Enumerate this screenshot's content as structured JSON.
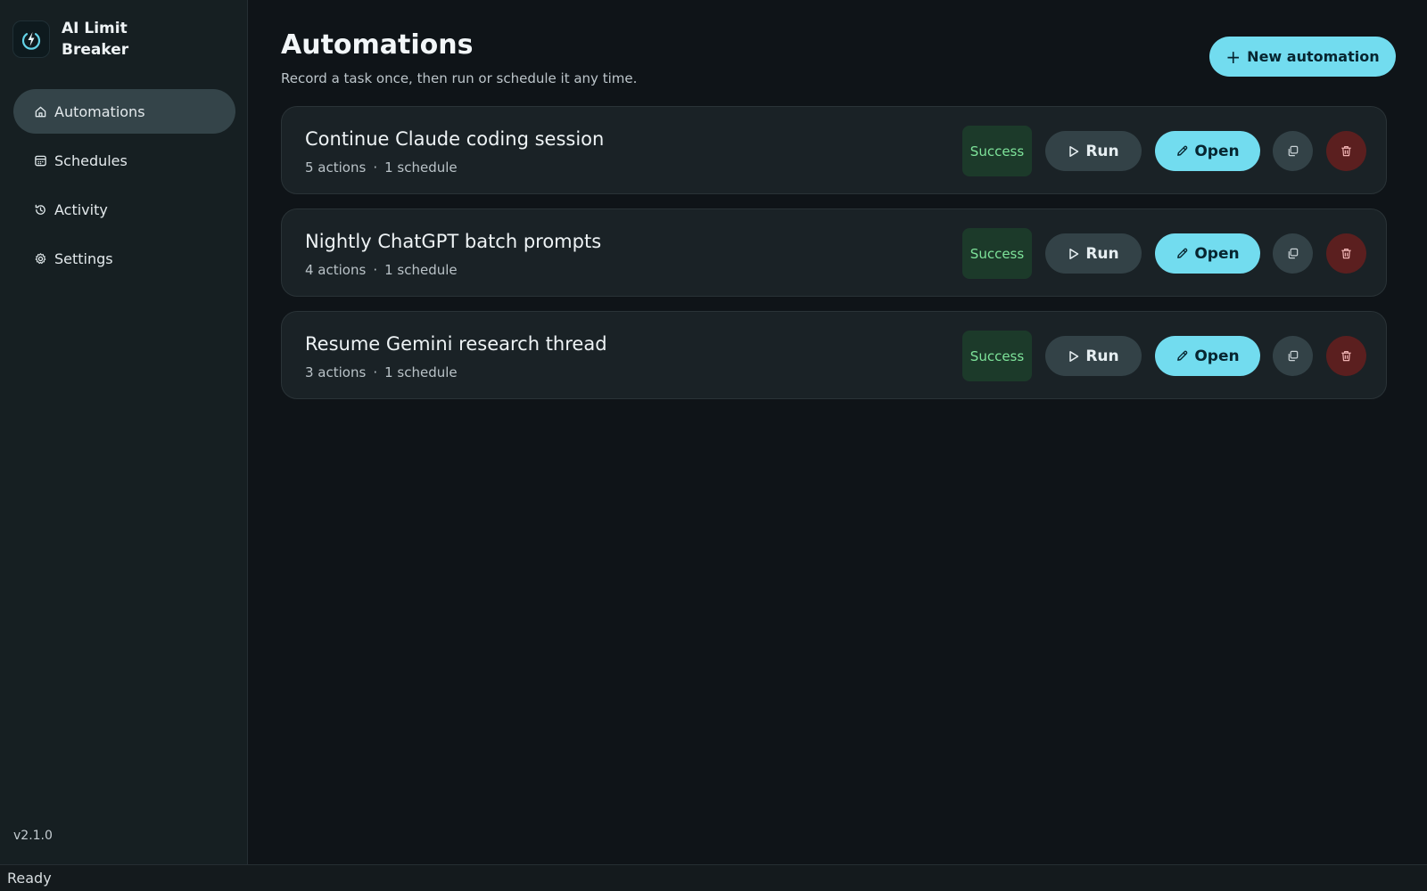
{
  "app": {
    "name": "AI Limit Breaker",
    "version": "v2.1.0",
    "status": "Ready",
    "logo_icon": "lightning-power-icon"
  },
  "sidebar": {
    "items": [
      {
        "label": "Automations",
        "icon": "home-icon",
        "active": true
      },
      {
        "label": "Schedules",
        "icon": "calendar-icon",
        "active": false
      },
      {
        "label": "Activity",
        "icon": "history-icon",
        "active": false
      },
      {
        "label": "Settings",
        "icon": "gear-icon",
        "active": false
      }
    ]
  },
  "header": {
    "title": "Automations",
    "subtitle": "Record a task once, then run or schedule it any time.",
    "new_button_label": "New automation"
  },
  "buttons": {
    "run_label": "Run",
    "open_label": "Open"
  },
  "automations": [
    {
      "title": "Continue Claude coding session",
      "actions": "5 actions",
      "schedules": "1 schedule",
      "status": "Success"
    },
    {
      "title": "Nightly ChatGPT batch prompts",
      "actions": "4 actions",
      "schedules": "1 schedule",
      "status": "Success"
    },
    {
      "title": "Resume Gemini research thread",
      "actions": "3 actions",
      "schedules": "1 schedule",
      "status": "Success"
    }
  ],
  "colors": {
    "accent": "#72dcef",
    "success_bg": "#1c3a2a",
    "success_text": "#7ee39a",
    "danger_bg": "#5b1f1f",
    "sidebar_active": "#344449"
  }
}
